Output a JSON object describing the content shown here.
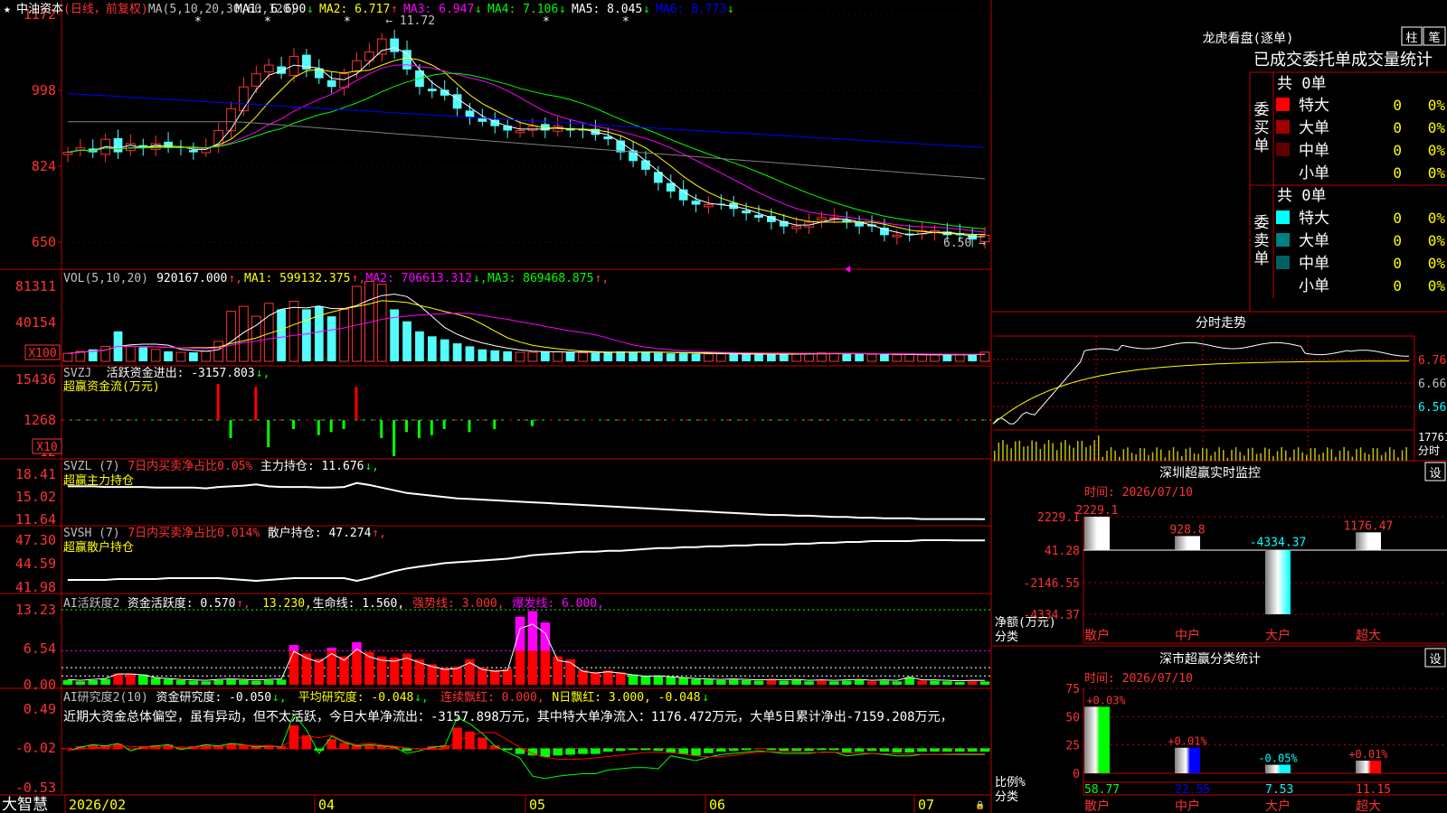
{
  "app": {
    "brand": "大智慧",
    "lock_icon": "lock-icon"
  },
  "colors": {
    "up": "#ff3232",
    "down": "#54fcfc",
    "green": "#00ff00",
    "grid": "#c00000",
    "ma1": "#ffffff",
    "ma2": "#ffff00",
    "ma3": "#ff00ff",
    "ma4": "#00ff00",
    "ma5": "#808080",
    "ma6": "#0000ff",
    "magenta": "#ff00ff"
  },
  "main": {
    "star_icon": "star-icon",
    "stock_name": "中油资本",
    "period": "(日线，前复权)",
    "ma_params": "MA(5,10,20,30,60,120)",
    "ma_values": [
      {
        "label": "MA1: 6.690",
        "arrow": "↓"
      },
      {
        "label": "MA2: 6.717",
        "arrow": "↑"
      },
      {
        "label": "MA3: 6.947",
        "arrow": "↓"
      },
      {
        "label": "MA4: 7.106",
        "arrow": "↓"
      },
      {
        "label": "MA5: 8.045",
        "arrow": "↓"
      },
      {
        "label": "MA6: 8.773",
        "arrow": "↓"
      }
    ],
    "y_ticks": [
      "1172",
      "998",
      "824",
      "650"
    ],
    "high_label": "← 11.72",
    "low_label": "6.50 →",
    "star_marks": [
      "*",
      "*",
      "*",
      "*",
      "*"
    ]
  },
  "vol": {
    "title": "VOL(5,10,20)",
    "value": "920167.000",
    "ma": [
      {
        "label": "MA1: 599132.375",
        "arrow": "↑"
      },
      {
        "label": "MA2: 706613.312",
        "arrow": "↓"
      },
      {
        "label": "MA3: 869468.875",
        "arrow": "↑"
      }
    ],
    "y_ticks": [
      "81311",
      "40154"
    ],
    "unit": "X100"
  },
  "svzj": {
    "title": "SVZJ",
    "metric": "活跃资金进出: -3157.803",
    "subtitle": "超赢资金流(万元)",
    "y_ticks": [
      "15436",
      "1268",
      "-12"
    ],
    "unit": "X10"
  },
  "svzl": {
    "title": "SVZL (7)",
    "pct": "7日内买卖净占比0.05%",
    "metric": "主力持仓: 11.676",
    "subtitle": "超赢主力持仓",
    "y_ticks": [
      "18.41",
      "15.02",
      "11.64"
    ]
  },
  "svsh": {
    "title": "SVSH (7)",
    "pct": "7日内买卖净占比0.014%",
    "metric": "散户持仓: 47.274",
    "subtitle": "超赢散户持仓",
    "y_ticks": [
      "47.30",
      "44.59",
      "41.98"
    ]
  },
  "ai1": {
    "title": "AI活跃度2",
    "metric": "资金活跃度: 0.570",
    "v2": "13.230,",
    "life": "生命线: 1.560,",
    "strong": "强势线: 3.000,",
    "burst": "爆发线: 6.000,",
    "y_ticks": [
      "13.23",
      "6.54",
      "0.00"
    ]
  },
  "ai2": {
    "title": "AI研究度2(10)",
    "metric": "资金研究度: -0.050",
    "avg": "平均研究度: -0.048",
    "red": "连续飘红: 0.000",
    "nred": "N日飘红: 3.000, -0.048",
    "desc": "近期大资金总体偏空，虽有异动，但不太活跃，今日大单净流出：-3157.898万元，其中特大单净流入：1176.472万元，大单5日累计净出-7159.208万元，",
    "y_ticks": [
      "0.49",
      "-0.02",
      "-0.53"
    ]
  },
  "x_axis": {
    "labels": [
      "2026/02",
      "04",
      "05",
      "06",
      "07"
    ]
  },
  "right": {
    "lhb": {
      "title": "龙虎看盘(逐单)",
      "btn1": "柱",
      "btn2": "笔",
      "subtitle": "已成交委托单成交量统计",
      "buy_label": "委买单",
      "sell_label": "委卖单",
      "buy_total": "共 0单",
      "sell_total": "共 0单",
      "buy_rows": [
        {
          "name": "特大",
          "count": "0",
          "pct": "0%",
          "color": "#ff0000"
        },
        {
          "name": "大单",
          "count": "0",
          "pct": "0%",
          "color": "#a00000"
        },
        {
          "name": "中单",
          "count": "0",
          "pct": "0%",
          "color": "#600000"
        },
        {
          "name": "小单",
          "count": "0",
          "pct": "0%",
          "color": ""
        }
      ],
      "sell_rows": [
        {
          "name": "特大",
          "count": "0",
          "pct": "0%",
          "color": "#00ffff"
        },
        {
          "name": "大单",
          "count": "0",
          "pct": "0%",
          "color": "#008080"
        },
        {
          "name": "中单",
          "count": "0",
          "pct": "0%",
          "color": "#006060"
        },
        {
          "name": "小单",
          "count": "0",
          "pct": "0%",
          "color": ""
        }
      ]
    },
    "intraday": {
      "title": "分时走势",
      "y_ticks": [
        "6.76",
        "6.66",
        "6.56"
      ],
      "vol_label": "17761",
      "vol_unit": "分时"
    },
    "monitor": {
      "title": "深圳超赢实时监控",
      "btn": "设",
      "date": "时间: 2026/07/10",
      "y_ticks": [
        "2229.1",
        "41.28",
        "-2146.55",
        "-4334.37"
      ],
      "axis_title": "净额(万元)",
      "axis_sub": "分类"
    },
    "stats": {
      "title": "深市超赢分类统计",
      "btn": "设",
      "date": "时间: 2026/07/10",
      "y_ticks": [
        "75",
        "50",
        "25",
        "0"
      ],
      "axis_title": "比例%",
      "axis_sub": "分类"
    }
  },
  "chart_data": [
    {
      "type": "candlestick",
      "title": "中油资本 (日线，前复权)",
      "ylim": [
        6.5,
        11.72
      ],
      "x_range": [
        "2026/02",
        "2026/07/10"
      ],
      "annotations": [
        {
          "label": "11.72",
          "kind": "high"
        },
        {
          "label": "6.50",
          "kind": "low"
        }
      ],
      "series": [
        {
          "name": "close",
          "values": [
            8.6,
            8.7,
            8.6,
            8.9,
            8.6,
            8.8,
            8.7,
            8.8,
            8.7,
            8.7,
            8.6,
            8.7,
            9.1,
            9.6,
            10.1,
            10.4,
            10.6,
            10.4,
            10.8,
            10.5,
            10.3,
            10.1,
            10.4,
            10.7,
            10.9,
            11.2,
            10.9,
            10.5,
            10.1,
            10.0,
            9.9,
            9.6,
            9.4,
            9.3,
            9.2,
            9.1,
            9.1,
            9.2,
            9.1,
            9.2,
            9.1,
            9.1,
            9.0,
            8.9,
            8.6,
            8.4,
            8.2,
            7.9,
            7.7,
            7.5,
            7.4,
            7.4,
            7.4,
            7.3,
            7.2,
            7.1,
            7.0,
            6.9,
            6.9,
            7.0,
            7.1,
            7.1,
            7.0,
            6.9,
            6.9,
            6.7,
            6.7,
            6.7,
            6.8,
            6.8,
            6.7,
            6.7,
            6.6,
            6.7
          ]
        }
      ],
      "ma_values": {
        "MA1": 6.69,
        "MA2": 6.717,
        "MA3": 6.947,
        "MA4": 7.106,
        "MA5": 8.045,
        "MA6": 8.773
      }
    },
    {
      "type": "bar",
      "title": "VOL(5,10,20)",
      "ylim": [
        0,
        81311
      ],
      "unit": "X100",
      "series": [
        {
          "name": "VOL",
          "values": [
            8000,
            10000,
            12000,
            15000,
            30000,
            15000,
            14000,
            12000,
            10000,
            9000,
            9000,
            10000,
            20000,
            50000,
            55000,
            45000,
            58000,
            52000,
            60000,
            52000,
            55000,
            45000,
            52000,
            75000,
            80000,
            77000,
            52000,
            40000,
            30000,
            25000,
            22000,
            18000,
            15000,
            12000,
            11000,
            10000,
            9000,
            9000,
            10000,
            9500,
            9000,
            8500,
            8500,
            9000,
            10000,
            9500,
            9000,
            8500,
            8000,
            8000,
            7500,
            7500,
            7500,
            7200,
            7000,
            6800,
            7000,
            7500,
            8000,
            8000,
            8500,
            8000,
            7500,
            7500,
            7000,
            6800,
            6500,
            6700,
            6500,
            6500,
            6500,
            6600,
            6800,
            9200
          ]
        }
      ],
      "values_text": {
        "VOL": 920167.0,
        "MA1": 599132.375,
        "MA2": 706613.312,
        "MA3": 869468.875
      }
    },
    {
      "type": "bar",
      "title": "SVZJ 超赢资金流(万元)",
      "ylim": [
        -12,
        15436
      ],
      "unit": "X10",
      "series": [
        {
          "name": "活跃资金进出",
          "values": [
            0,
            0,
            0,
            0,
            0,
            0,
            0,
            0,
            0,
            0,
            0,
            0,
            12000,
            -6000,
            0,
            11000,
            -9000,
            0,
            -3000,
            0,
            -5000,
            -4000,
            -3000,
            11000,
            0,
            -6000,
            -12000,
            -4000,
            -6000,
            -5000,
            -3000,
            0,
            -4000,
            0,
            -3000,
            0,
            0,
            -2000,
            0,
            0,
            0,
            0,
            0,
            0,
            0,
            0,
            0,
            0,
            0,
            0,
            0,
            0,
            0,
            0,
            0,
            0,
            0,
            0,
            0,
            0,
            0,
            0,
            0,
            0,
            0,
            0,
            0,
            0,
            0,
            0,
            0,
            0,
            0,
            0
          ]
        }
      ],
      "values_text": {
        "活跃资金进出": -3157.803
      }
    },
    {
      "type": "line",
      "title": "SVZL 超赢主力持仓",
      "ylim": [
        11.64,
        18.41
      ],
      "series": [
        {
          "name": "主力持仓",
          "values": [
            16.6,
            16.6,
            16.6,
            16.5,
            16.5,
            16.5,
            16.5,
            16.4,
            16.4,
            16.4,
            16.4,
            16.3,
            16.5,
            16.6,
            16.7,
            16.9,
            16.6,
            16.5,
            16.5,
            16.5,
            16.4,
            16.4,
            16.5,
            17.1,
            16.8,
            16.4,
            16.0,
            15.6,
            15.4,
            15.2,
            15.0,
            14.8,
            14.7,
            14.6,
            14.5,
            14.4,
            14.3,
            14.2,
            14.1,
            14.0,
            13.9,
            13.8,
            13.7,
            13.6,
            13.5,
            13.4,
            13.3,
            13.2,
            13.1,
            13.0,
            12.9,
            12.8,
            12.7,
            12.6,
            12.5,
            12.4,
            12.3,
            12.3,
            12.2,
            12.2,
            12.1,
            12.0,
            12.0,
            11.9,
            11.9,
            11.8,
            11.8,
            11.8,
            11.7,
            11.7,
            11.7,
            11.7,
            11.7,
            11.68
          ]
        }
      ],
      "values_text": {
        "主力持仓": 11.676
      }
    },
    {
      "type": "line",
      "title": "SVSH 超赢散户持仓",
      "ylim": [
        41.98,
        47.3
      ],
      "series": [
        {
          "name": "散户持仓",
          "values": [
            42.8,
            42.8,
            42.8,
            42.8,
            42.9,
            42.9,
            42.9,
            42.9,
            43.0,
            43.0,
            43.0,
            43.0,
            43.0,
            42.9,
            42.8,
            42.7,
            42.8,
            42.9,
            43.0,
            43.0,
            43.0,
            43.0,
            43.0,
            42.7,
            43.0,
            43.4,
            43.8,
            44.1,
            44.3,
            44.5,
            44.7,
            44.8,
            44.9,
            45.0,
            45.1,
            45.2,
            45.4,
            45.6,
            45.7,
            45.8,
            45.9,
            46.0,
            46.0,
            46.1,
            46.1,
            46.2,
            46.3,
            46.4,
            46.4,
            46.5,
            46.5,
            46.6,
            46.6,
            46.7,
            46.7,
            46.8,
            46.8,
            46.8,
            46.9,
            46.9,
            47.0,
            47.0,
            47.1,
            47.1,
            47.2,
            47.2,
            47.2,
            47.2,
            47.3,
            47.3,
            47.3,
            47.28,
            47.28,
            47.274
          ]
        }
      ],
      "values_text": {
        "散户持仓": 47.274
      }
    },
    {
      "type": "bar",
      "title": "AI活跃度2",
      "ylim": [
        0,
        13.23
      ],
      "series": [
        {
          "name": "资金活跃度",
          "values": [
            0.8,
            0.6,
            0.8,
            1.0,
            2.0,
            2.0,
            1.8,
            1.2,
            1.0,
            0.8,
            0.7,
            0.6,
            0.8,
            0.9,
            0.8,
            0.7,
            0.8,
            0.9,
            7.0,
            5.5,
            4.6,
            6.5,
            5.0,
            7.5,
            5.8,
            5.0,
            4.8,
            5.5,
            4.5,
            3.6,
            3.0,
            3.2,
            4.5,
            3.0,
            2.6,
            2.8,
            12.0,
            13.0,
            11.0,
            5.0,
            4.5,
            2.6,
            2.2,
            2.5,
            2.2,
            1.8,
            1.5,
            1.6,
            1.4,
            1.2,
            1.0,
            0.9,
            0.8,
            0.9,
            0.8,
            0.7,
            0.8,
            0.7,
            0.8,
            0.6,
            0.7,
            0.6,
            0.7,
            0.8,
            0.6,
            0.7,
            0.6,
            1.3,
            0.7,
            0.7,
            0.6,
            0.5,
            0.6,
            0.57
          ]
        }
      ],
      "lines": {
        "强势线": 3.0,
        "爆发线": 6.0,
        "生命线": 1.56
      },
      "values_text": {
        "资金活跃度": 0.57
      }
    },
    {
      "type": "bar",
      "title": "AI研究度2(10)",
      "ylim": [
        -0.53,
        0.49
      ],
      "series": [
        {
          "name": "资金研究度",
          "values": [
            -0.02,
            0.01,
            0.03,
            0.02,
            0.04,
            -0.02,
            0.01,
            0.02,
            0.03,
            -0.01,
            0.01,
            0.03,
            0.02,
            0.04,
            0.03,
            0.01,
            0.02,
            0.01,
            0.28,
            0.15,
            -0.04,
            0.1,
            0.05,
            0.02,
            0.03,
            0.02,
            0.01,
            -0.04,
            -0.02,
            0.01,
            0.02,
            0.25,
            0.2,
            0.12,
            0.02,
            -0.03,
            -0.08,
            -0.1,
            -0.12,
            -0.1,
            -0.09,
            -0.08,
            -0.08,
            -0.05,
            -0.04,
            -0.03,
            -0.03,
            -0.04,
            -0.06,
            -0.08,
            -0.1,
            -0.07,
            -0.05,
            -0.04,
            -0.03,
            -0.02,
            -0.03,
            -0.04,
            -0.04,
            -0.04,
            -0.03,
            -0.03,
            -0.06,
            -0.05,
            -0.04,
            -0.05,
            -0.06,
            -0.06,
            -0.05,
            -0.05,
            -0.05,
            -0.05,
            -0.05,
            -0.05
          ]
        }
      ],
      "values_text": {
        "资金研究度": -0.05,
        "平均研究度": -0.048
      }
    },
    {
      "type": "bar",
      "title": "深圳超赢实时监控",
      "ylim": [
        -4334.37,
        2229.1
      ],
      "categories": [
        "散户",
        "中户",
        "大户",
        "超大"
      ],
      "values": [
        2229.1,
        928.8,
        -4334.37,
        1176.47
      ],
      "value_labels": [
        "2229.1",
        "928.8",
        "-4334.37",
        "1176.47"
      ]
    },
    {
      "type": "bar",
      "title": "深市超赢分类统计",
      "ylim": [
        0,
        75
      ],
      "categories": [
        "散户",
        "中户",
        "大户",
        "超大"
      ],
      "values": [
        58.77,
        22.55,
        7.53,
        11.15
      ],
      "changes": [
        "+0.03%",
        "+0.01%",
        "-0.05%",
        "+0.01%"
      ],
      "value_labels": [
        "58.77",
        "22.55",
        "7.53",
        "11.15"
      ],
      "colors": [
        "#00ff00",
        "#0000ff",
        "#00ffff",
        "#ff0000"
      ]
    }
  ]
}
